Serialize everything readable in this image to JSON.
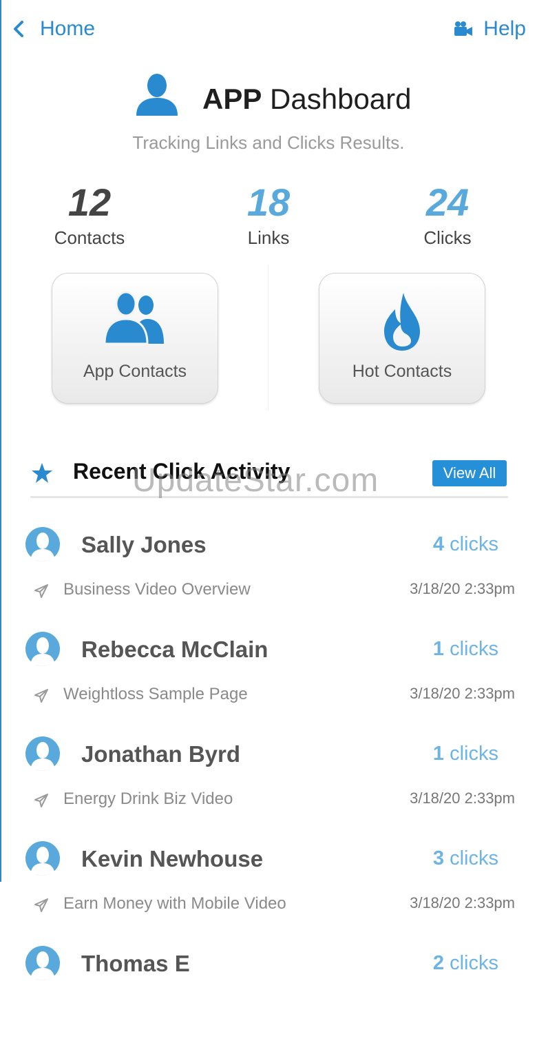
{
  "nav": {
    "back_label": "Home",
    "help_label": "Help"
  },
  "header": {
    "title_bold": "APP",
    "title_rest": "Dashboard",
    "subtitle": "Tracking Links and Clicks Results."
  },
  "stats": [
    {
      "value": "12",
      "label": "Contacts",
      "color": "#444444"
    },
    {
      "value": "18",
      "label": "Links",
      "color": "#5aa9dc"
    },
    {
      "value": "24",
      "label": "Clicks",
      "color": "#5aa9dc"
    }
  ],
  "tiles": [
    {
      "label": "App Contacts",
      "icon": "users-icon"
    },
    {
      "label": "Hot Contacts",
      "icon": "flame-icon"
    }
  ],
  "activity": {
    "title": "Recent Click Activity",
    "view_all_label": "View All",
    "items": [
      {
        "name": "Sally Jones",
        "count": "4",
        "unit": "clicks",
        "page": "Business Video Overview",
        "time": "3/18/20 2:33pm"
      },
      {
        "name": "Rebecca McClain",
        "count": "1",
        "unit": "clicks",
        "page": "Weightloss Sample Page",
        "time": "3/18/20 2:33pm"
      },
      {
        "name": "Jonathan Byrd",
        "count": "1",
        "unit": "clicks",
        "page": "Energy Drink Biz Video",
        "time": "3/18/20 2:33pm"
      },
      {
        "name": "Kevin Newhouse",
        "count": "3",
        "unit": "clicks",
        "page": "Earn Money with Mobile Video",
        "time": "3/18/20 2:33pm"
      },
      {
        "name": "Thomas E",
        "count": "2",
        "unit": "clicks",
        "page": "",
        "time": ""
      }
    ]
  },
  "watermark": "UpdateStar.com",
  "colors": {
    "accent": "#2a8ad0",
    "button": "#2590d8",
    "clicks_text": "#6cb4e4"
  }
}
